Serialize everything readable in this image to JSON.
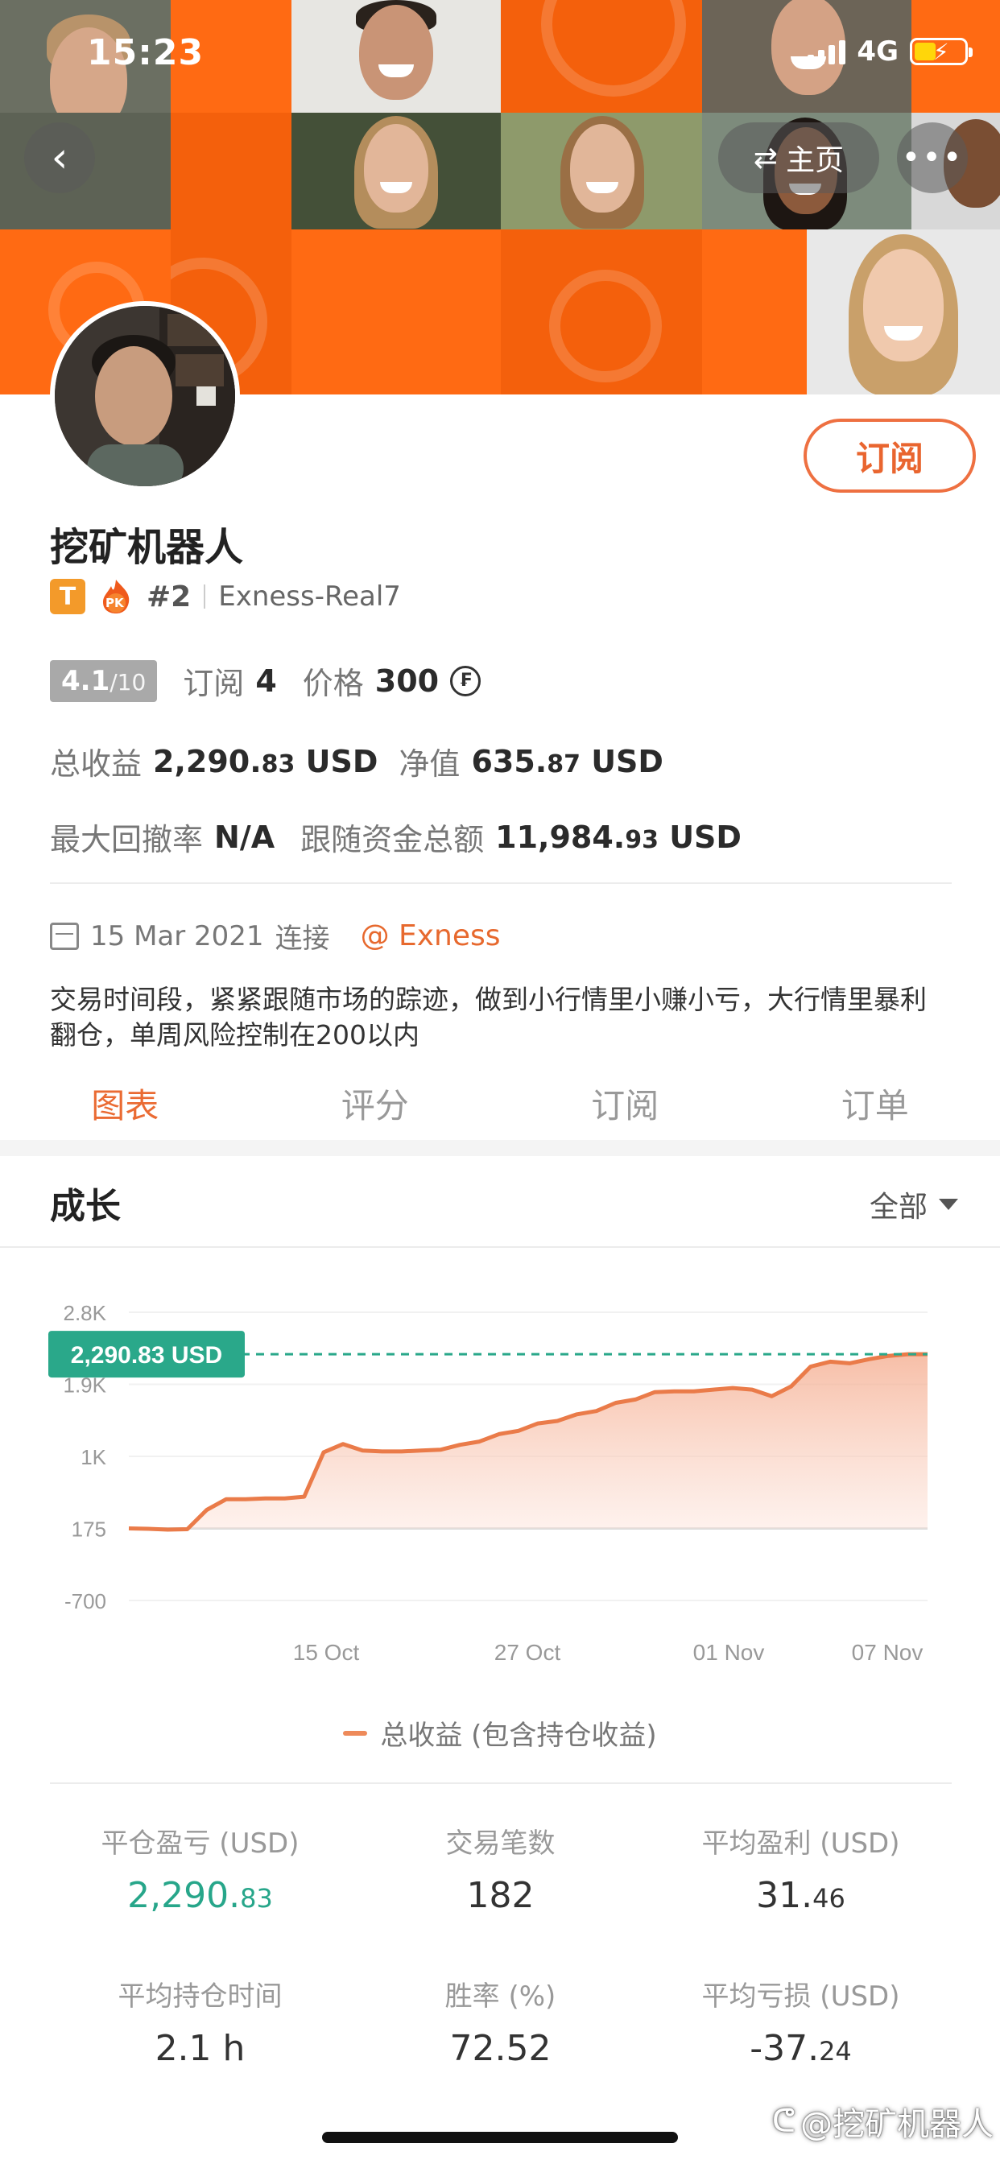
{
  "status_bar": {
    "time": "15:23",
    "network": "4G"
  },
  "nav": {
    "home_label": "主页",
    "back_icon": "chevron-left-icon",
    "more_icon": "more-dots-icon",
    "swap_icon": "swap-arrows-icon"
  },
  "profile": {
    "name": "挖矿机器人",
    "subscribe_label": "订阅",
    "badge_t": "T",
    "badge_pk": "PK",
    "rank": "#2",
    "server": "Exness-Real7",
    "rating": "4.1",
    "rating_max": "/10",
    "subscribe_text": "订阅",
    "subscribers": "4",
    "price_label": "价格",
    "price": "300",
    "coin_symbol": "₣",
    "total_profit_label": "总收益",
    "total_profit_int": "2,290.",
    "total_profit_dec": "83",
    "net_value_label": "净值",
    "net_value_int": "635.",
    "net_value_dec": "87",
    "currency": "USD",
    "max_drawdown_label": "最大回撤率",
    "max_drawdown": "N/A",
    "follow_funds_label": "跟随资金总额",
    "follow_funds_int": "11,984.",
    "follow_funds_dec": "93",
    "joined_date": "15 Mar 2021",
    "joined_label": "连接",
    "broker": "@ Exness",
    "description": "交易时间段，紧紧跟随市场的踪迹，做到小行情里小赚小亏，大行情里暴利翻仓，单周风险控制在200以内"
  },
  "tabs": [
    {
      "label": "图表",
      "active": true
    },
    {
      "label": "评分",
      "active": false
    },
    {
      "label": "订阅",
      "active": false
    },
    {
      "label": "订单",
      "active": false
    }
  ],
  "growth": {
    "title": "成长",
    "filter_label": "全部"
  },
  "chart_data": {
    "type": "area",
    "y_ticks": [
      "2.8K",
      "1.9K",
      "1K",
      "175",
      "-700"
    ],
    "ylim": [
      -700,
      2800
    ],
    "x_ticks": [
      "15 Oct",
      "27 Oct",
      "01 Nov",
      "07 Nov"
    ],
    "current_label": "2,290.83 USD",
    "current_value": 2290.83,
    "series": [
      {
        "name": "总收益 (包含持仓收益)",
        "values": [
          175,
          170,
          160,
          165,
          400,
          530,
          530,
          540,
          540,
          560,
          1100,
          1200,
          1120,
          1110,
          1110,
          1120,
          1130,
          1190,
          1230,
          1320,
          1360,
          1450,
          1480,
          1560,
          1600,
          1700,
          1740,
          1830,
          1840,
          1840,
          1860,
          1880,
          1860,
          1780,
          1900,
          2140,
          2200,
          2180,
          2230,
          2270,
          2290.83,
          2290.83
        ]
      }
    ],
    "color": "#ee8a5a"
  },
  "stats": [
    {
      "label": "平仓盈亏 (USD)",
      "int": "2,290.",
      "dec": "83",
      "green": true
    },
    {
      "label": "交易笔数",
      "int": "182",
      "dec": "",
      "green": false
    },
    {
      "label": "平均盈利 (USD)",
      "int": "31.",
      "dec": "46",
      "green": false
    },
    {
      "label": "平均持仓时间",
      "int": "2.1 h",
      "dec": "",
      "green": false
    },
    {
      "label": "胜率 (%)",
      "int": "72.52",
      "dec": "",
      "green": false
    },
    {
      "label": "平均亏损 (USD)",
      "int": "-37.",
      "dec": "24",
      "green": false
    }
  ],
  "watermark": "@挖矿机器人"
}
